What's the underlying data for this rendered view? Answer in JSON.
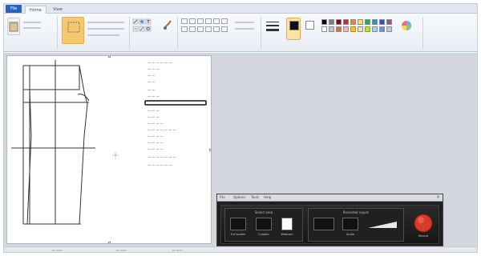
{
  "ribbon_tabs": {
    "file": "File",
    "home": "Home",
    "view": "View"
  },
  "colors": {
    "accent_blue": "#2a62b8",
    "selected_tool": "#f5c96b",
    "record_red": "#d83a2a",
    "primary_color": "#111111",
    "secondary_color": "#ffffff",
    "palette": [
      "#000000",
      "#7f7f7f",
      "#880015",
      "#ed1c24",
      "#ff7f27",
      "#fff200",
      "#22b14c",
      "#00a2e8",
      "#3f48cc",
      "#a349a4",
      "#ffffff",
      "#c3c3c3",
      "#b97a57",
      "#ffaec9",
      "#ffc90e",
      "#efe4b0",
      "#b5e61d",
      "#99d9ea",
      "#7092be",
      "#c8bfe7"
    ]
  },
  "recorder": {
    "menu": [
      "File",
      "Options",
      "Tools",
      "Help"
    ],
    "groups": [
      "Select area",
      "Recorded inputs"
    ],
    "buttons": [
      "Full screen",
      "Custom",
      "Webcam",
      "Audio",
      "Record"
    ]
  }
}
